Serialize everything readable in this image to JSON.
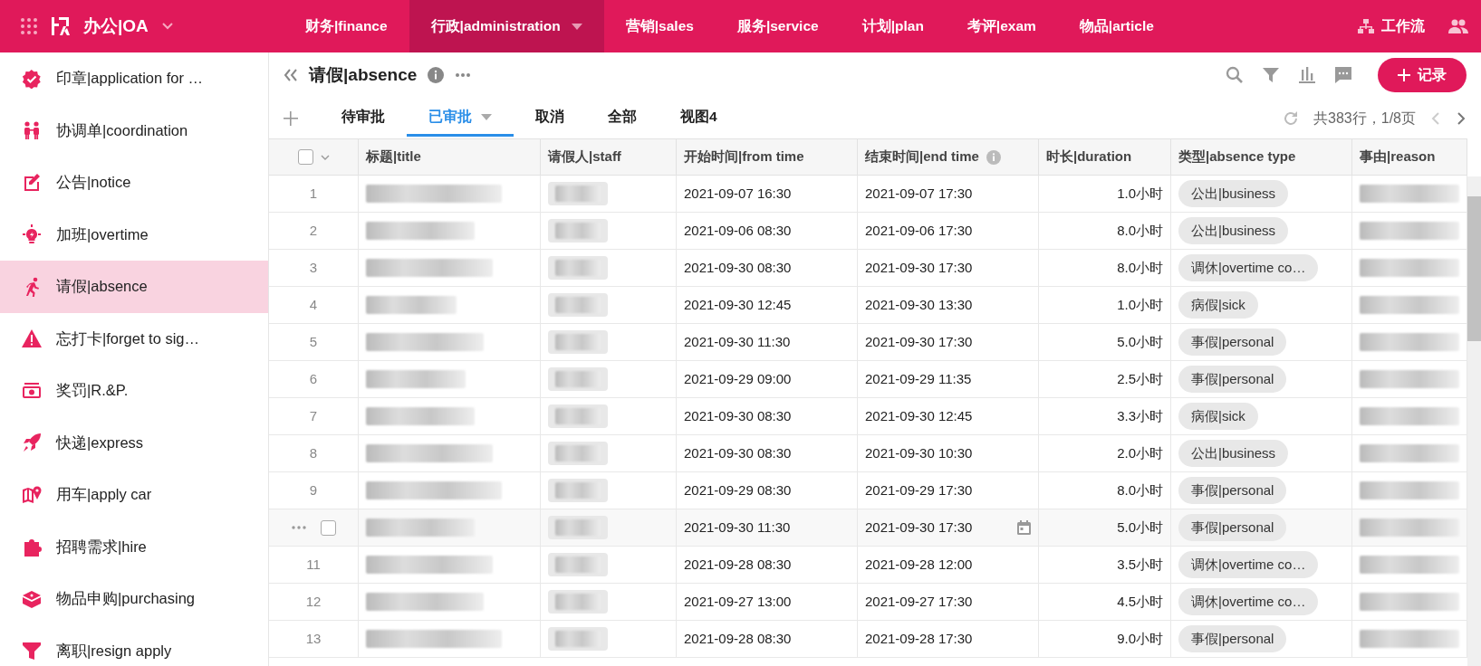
{
  "app": {
    "title": "办公|OA"
  },
  "top_nav": [
    {
      "label": "财务|finance",
      "selected": false,
      "has_menu": false
    },
    {
      "label": "行政|administration",
      "selected": true,
      "has_menu": true
    },
    {
      "label": "营销|sales",
      "selected": false,
      "has_menu": false
    },
    {
      "label": "服务|service",
      "selected": false,
      "has_menu": false
    },
    {
      "label": "计划|plan",
      "selected": false,
      "has_menu": false
    },
    {
      "label": "考评|exam",
      "selected": false,
      "has_menu": false
    },
    {
      "label": "物品|article",
      "selected": false,
      "has_menu": false
    }
  ],
  "top_actions": [
    {
      "kind": "workflow",
      "label": "工作流"
    },
    {
      "kind": "users"
    }
  ],
  "sidebar": [
    {
      "label": "印章|application for …",
      "selected": false
    },
    {
      "label": "协调单|coordination",
      "selected": false
    },
    {
      "label": "公告|notice",
      "selected": false
    },
    {
      "label": "加班|overtime",
      "selected": false
    },
    {
      "label": "请假|absence",
      "selected": true
    },
    {
      "label": "忘打卡|forget to sig…",
      "selected": false
    },
    {
      "label": "奖罚|R.&P.",
      "selected": false
    },
    {
      "label": "快递|express",
      "selected": false
    },
    {
      "label": "用车|apply car",
      "selected": false
    },
    {
      "label": "招聘需求|hire",
      "selected": false
    },
    {
      "label": "物品申购|purchasing",
      "selected": false
    },
    {
      "label": "离职|resign apply",
      "selected": false
    }
  ],
  "page": {
    "title": "请假|absence"
  },
  "views": [
    {
      "label": "待审批",
      "selected": false,
      "has_menu": false
    },
    {
      "label": "已审批",
      "selected": true,
      "has_menu": true
    },
    {
      "label": "取消",
      "selected": false,
      "has_menu": false
    },
    {
      "label": "全部",
      "selected": false,
      "has_menu": false
    },
    {
      "label": "视图4",
      "selected": false,
      "has_menu": false
    }
  ],
  "record_button": {
    "label": "记录"
  },
  "pager": {
    "summary": "共383行，1/8页"
  },
  "table": {
    "select_all_checked": false,
    "columns": [
      {
        "label": "标题|title",
        "has_info": false
      },
      {
        "label": "请假人|staff",
        "has_info": false
      },
      {
        "label": "开始时间|from time",
        "has_info": false
      },
      {
        "label": "结束时间|end time",
        "has_info": true
      },
      {
        "label": "时长|duration",
        "has_info": false
      },
      {
        "label": "类型|absence type",
        "has_info": false
      },
      {
        "label": "事由|reason",
        "has_info": false
      }
    ],
    "rows": [
      {
        "number": "1",
        "from": "2021-09-07 16:30",
        "end": "2021-09-07 17:30",
        "duration": "1.0小时",
        "type": "公出|business",
        "hovered": false,
        "checked": false
      },
      {
        "number": "2",
        "from": "2021-09-06 08:30",
        "end": "2021-09-06 17:30",
        "duration": "8.0小时",
        "type": "公出|business",
        "hovered": false,
        "checked": false
      },
      {
        "number": "3",
        "from": "2021-09-30 08:30",
        "end": "2021-09-30 17:30",
        "duration": "8.0小时",
        "type": "调休|overtime co…",
        "hovered": false,
        "checked": false
      },
      {
        "number": "4",
        "from": "2021-09-30 12:45",
        "end": "2021-09-30 13:30",
        "duration": "1.0小时",
        "type": "病假|sick",
        "hovered": false,
        "checked": false
      },
      {
        "number": "5",
        "from": "2021-09-30 11:30",
        "end": "2021-09-30 17:30",
        "duration": "5.0小时",
        "type": "事假|personal",
        "hovered": false,
        "checked": false
      },
      {
        "number": "6",
        "from": "2021-09-29 09:00",
        "end": "2021-09-29 11:35",
        "duration": "2.5小时",
        "type": "事假|personal",
        "hovered": false,
        "checked": false
      },
      {
        "number": "7",
        "from": "2021-09-30 08:30",
        "end": "2021-09-30 12:45",
        "duration": "3.3小时",
        "type": "病假|sick",
        "hovered": false,
        "checked": false
      },
      {
        "number": "8",
        "from": "2021-09-30 08:30",
        "end": "2021-09-30 10:30",
        "duration": "2.0小时",
        "type": "公出|business",
        "hovered": false,
        "checked": false
      },
      {
        "number": "9",
        "from": "2021-09-29 08:30",
        "end": "2021-09-29 17:30",
        "duration": "8.0小时",
        "type": "事假|personal",
        "hovered": false,
        "checked": false
      },
      {
        "from": "2021-09-30 11:30",
        "end": "2021-09-30 17:30",
        "duration": "5.0小时",
        "type": "事假|personal",
        "hovered": true,
        "checked": false
      },
      {
        "number": "11",
        "from": "2021-09-28 08:30",
        "end": "2021-09-28 12:00",
        "duration": "3.5小时",
        "type": "调休|overtime co…",
        "hovered": false,
        "checked": false
      },
      {
        "number": "12",
        "from": "2021-09-27 13:00",
        "end": "2021-09-27 17:30",
        "duration": "4.5小时",
        "type": "调休|overtime co…",
        "hovered": false,
        "checked": false
      },
      {
        "number": "13",
        "from": "2021-09-28 08:30",
        "end": "2021-09-28 17:30",
        "duration": "9.0小时",
        "type": "事假|personal",
        "hovered": false,
        "checked": false
      }
    ]
  }
}
